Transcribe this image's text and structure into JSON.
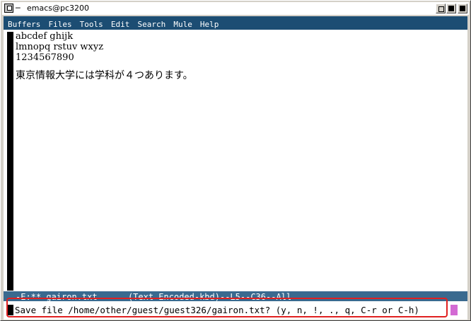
{
  "window": {
    "title": "emacs@pc3200"
  },
  "menubar": {
    "items": [
      "Buffers",
      "Files",
      "Tools",
      "Edit",
      "Search",
      "Mule",
      "Help"
    ]
  },
  "buffer": {
    "lines": [
      "abcdef ghijk",
      "lmnopq rstuv wxyz",
      "1234567890",
      "東京情報大学には学科が４つあります。"
    ]
  },
  "modeline": {
    "text": "-E:** gairon.txt      (Text Encoded-kbd)--L5--C36--All"
  },
  "minibuffer": {
    "prompt": "Save file /home/other/guest/guest326/gairon.txt? (y, n, !, ., q, C-r or C-h)"
  },
  "colors": {
    "menubar_bg": "#1c4d73",
    "modeline_bg": "#3a6a8f",
    "cursor": "#d36ad3",
    "highlight": "#e02020"
  }
}
